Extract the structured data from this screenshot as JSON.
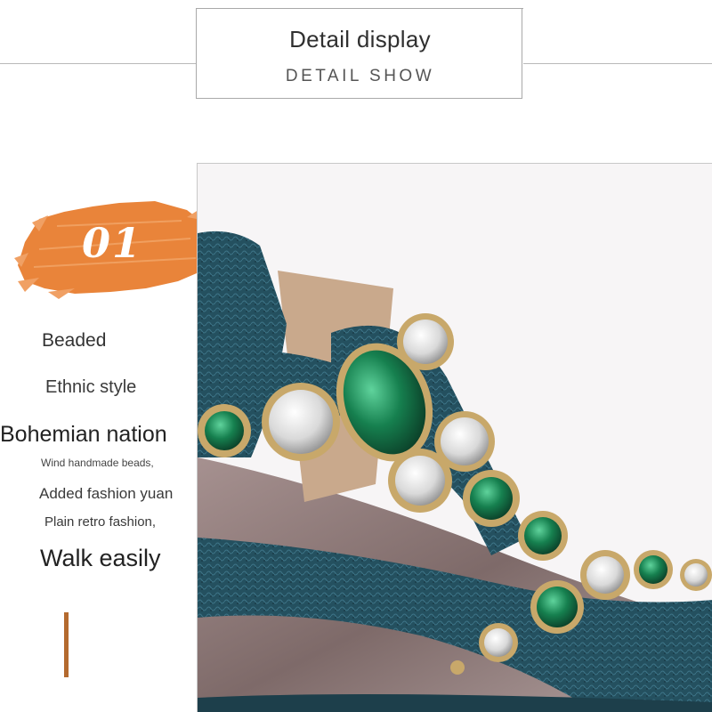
{
  "header": {
    "title": "Detail display",
    "subtitle": "DETAIL SHOW"
  },
  "badge": {
    "number": "01",
    "color": "#e9843a"
  },
  "features": {
    "line1": "Beaded",
    "line2": "Ethnic style",
    "line3": "Bohemian nation",
    "line4": "Wind handmade beads,",
    "line5": "Added fashion yuan",
    "line6": "Plain retro fashion,",
    "line7": "Walk easily"
  },
  "colors": {
    "accent": "#b46a2e",
    "strap": "#2b5565",
    "gem_green": "#1f7a4f",
    "insole": "#8f7a78"
  },
  "photo": {
    "subject": "sandal-detail-image"
  }
}
